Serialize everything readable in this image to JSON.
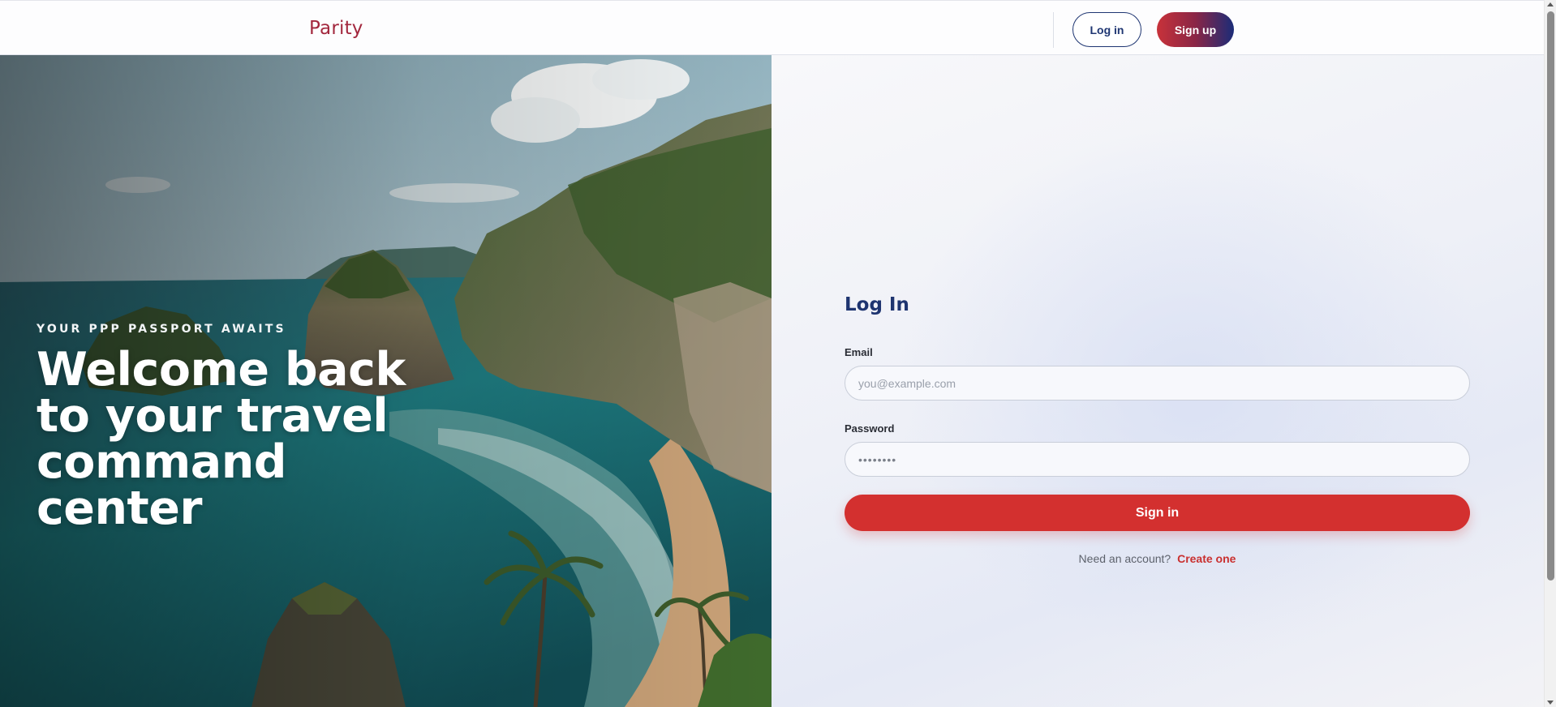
{
  "header": {
    "brand": "Parity",
    "login_label": "Log in",
    "signup_label": "Sign up"
  },
  "hero": {
    "eyebrow": "YOUR PPP PASSPORT AWAITS",
    "headline_lines": [
      "Welcome back",
      "to your travel",
      "command",
      "center"
    ],
    "image_desc_icon": "coastal-cliffs-beach-image"
  },
  "login_form": {
    "title": "Log In",
    "email_label": "Email",
    "email_placeholder": "you@example.com",
    "email_value": "",
    "password_label": "Password",
    "password_placeholder": "••••••••",
    "password_value": "",
    "submit_label": "Sign in",
    "switch_prompt": "Need an account?",
    "switch_link": "Create one"
  },
  "colors": {
    "brand": "#a3283e",
    "navy": "#1f3672",
    "accent_red": "#d3302f"
  }
}
